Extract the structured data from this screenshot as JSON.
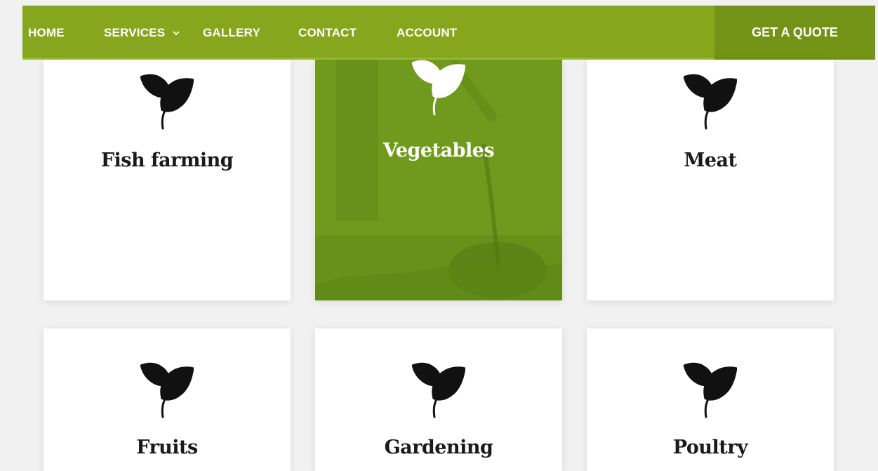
{
  "nav": {
    "items": [
      "HOME",
      "SERVICES",
      "GALLERY",
      "CONTACT",
      "ACCOUNT"
    ],
    "cta": "GET A QUOTE"
  },
  "services": [
    {
      "title": "Fish farming",
      "icon": "leaf-icon",
      "active": false
    },
    {
      "title": "Vegetables",
      "icon": "leaf-icon",
      "active": true
    },
    {
      "title": "Meat",
      "icon": "leaf-icon",
      "active": false
    },
    {
      "title": "Fruits",
      "icon": "leaf-icon",
      "active": false
    },
    {
      "title": "Gardening",
      "icon": "leaf-icon",
      "active": false
    },
    {
      "title": "Poultry",
      "icon": "leaf-icon",
      "active": false
    }
  ],
  "colors": {
    "nav_bg": "#86a71d",
    "cta_bg": "#739317",
    "active_card": "#6f9a1d",
    "icon": "#111111"
  }
}
